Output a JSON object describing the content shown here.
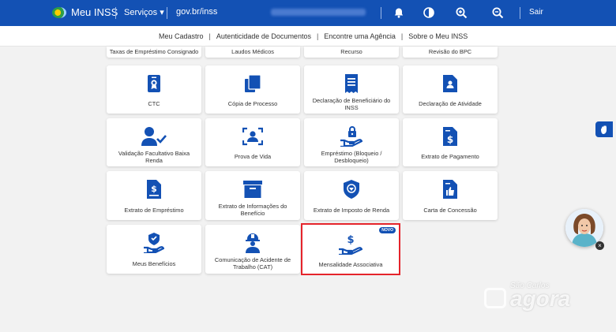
{
  "topbar": {
    "brand": "Meu INSS",
    "servicos": "Serviços",
    "govbr": "gov.br/inss",
    "sair": "Sair",
    "icons": [
      "bell-icon",
      "contrast-icon",
      "zoom-in-icon",
      "zoom-out-icon"
    ],
    "color": "#1351b4"
  },
  "subnav": {
    "items": [
      "Meu Cadastro",
      "Autenticidade de Documentos",
      "Encontre uma Agência",
      "Sobre o Meu INSS"
    ]
  },
  "partial_row": [
    "Taxas de Empréstimo Consignado",
    "Laudos Médicos",
    "Recurso",
    "Revisão do BPC"
  ],
  "cards": [
    {
      "label": "CTC",
      "icon": "badge-icon"
    },
    {
      "label": "Cópia de Processo",
      "icon": "copy-icon"
    },
    {
      "label": "Declaração de Beneficiário do INSS",
      "icon": "receipt-icon"
    },
    {
      "label": "Declaração de Atividade",
      "icon": "document-person-icon"
    },
    {
      "label": "Validação Facultativo Baixa Renda",
      "icon": "user-check-icon"
    },
    {
      "label": "Prova de Vida",
      "icon": "face-scan-icon"
    },
    {
      "label": "Empréstimo (Bloqueio / Desbloqueio)",
      "icon": "hand-lock-icon"
    },
    {
      "label": "Extrato de Pagamento",
      "icon": "document-dollar-icon"
    },
    {
      "label": "Extrato de Empréstimo",
      "icon": "document-dollar-icon"
    },
    {
      "label": "Extrato de Informações do Benefício",
      "icon": "archive-icon"
    },
    {
      "label": "Extrato de Imposto de Renda",
      "icon": "lion-shield-icon"
    },
    {
      "label": "Carta de Concessão",
      "icon": "document-thumbs-up-icon"
    },
    {
      "label": "Meus Benefícios",
      "icon": "hand-shield-icon"
    },
    {
      "label": "Comunicação de Acidente de Trabalho (CAT)",
      "icon": "worker-icon"
    },
    {
      "label": "Mensalidade Associativa",
      "icon": "hand-dollar-icon",
      "badge": "NOVO",
      "highlighted": true
    }
  ],
  "watermark": {
    "small": "São Carlos",
    "big": "agora"
  },
  "colors": {
    "accent": "#1351b4",
    "highlight": "#e5242b"
  }
}
